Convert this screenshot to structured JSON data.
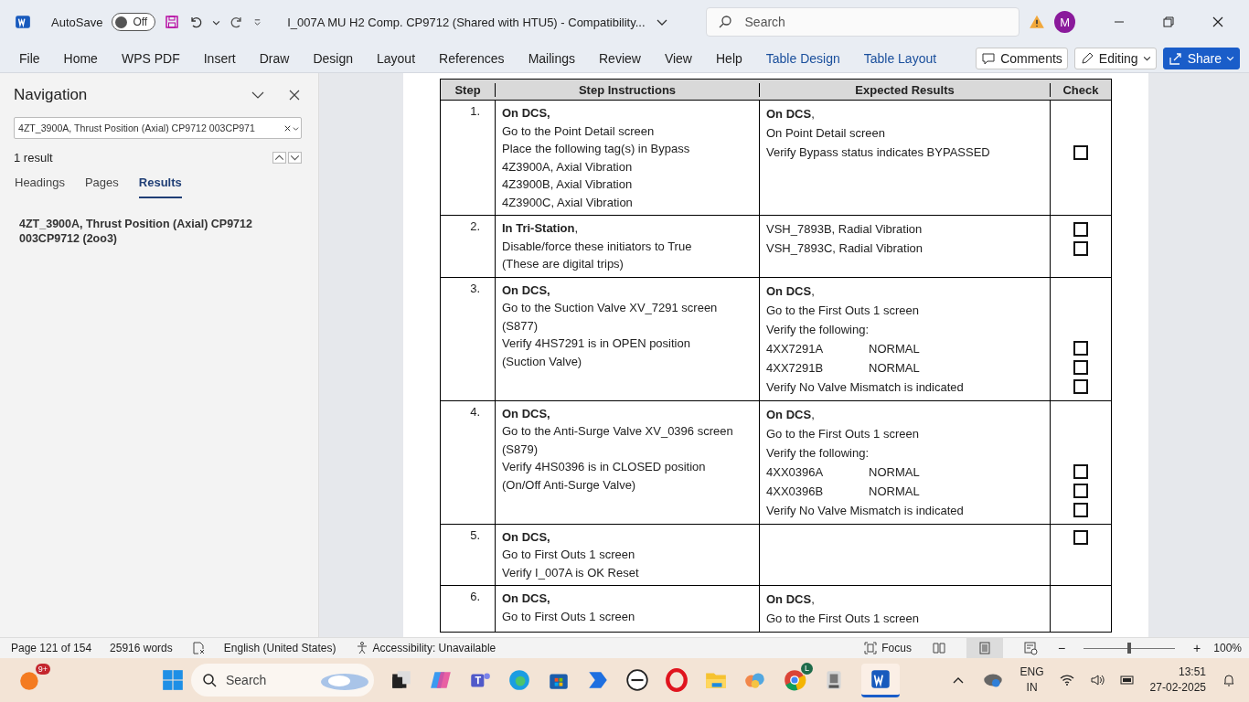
{
  "titlebar": {
    "autosave_label": "AutoSave",
    "autosave": {
      "label": "Off",
      "on": false
    },
    "document_title": "I_007A MU H2 Comp. CP9712 (Shared with HTU5)  -  Compatibility...",
    "search": {
      "placeholder": "Search"
    },
    "avatar": "M"
  },
  "ribbon": {
    "tabs": [
      {
        "label": "File",
        "kind": "standard"
      },
      {
        "label": "Home",
        "kind": "standard"
      },
      {
        "label": "WPS PDF",
        "kind": "standard"
      },
      {
        "label": "Insert",
        "kind": "standard"
      },
      {
        "label": "Draw",
        "kind": "standard"
      },
      {
        "label": "Design",
        "kind": "standard"
      },
      {
        "label": "Layout",
        "kind": "standard"
      },
      {
        "label": "References",
        "kind": "standard"
      },
      {
        "label": "Mailings",
        "kind": "standard"
      },
      {
        "label": "Review",
        "kind": "standard"
      },
      {
        "label": "View",
        "kind": "standard"
      },
      {
        "label": "Help",
        "kind": "standard"
      },
      {
        "label": "Table Design",
        "kind": "contextual"
      },
      {
        "label": "Table Layout",
        "kind": "contextual"
      }
    ],
    "comments": "Comments",
    "editing": "Editing",
    "share": "Share"
  },
  "navigation": {
    "title": "Navigation",
    "search": {
      "value": "4ZT_3900A, Thrust Position (Axial) CP9712 003CP971"
    },
    "result_count": "1 result",
    "tabs": [
      {
        "label": "Headings",
        "selected": false
      },
      {
        "label": "Pages",
        "selected": false
      },
      {
        "label": "Results",
        "selected": true
      }
    ],
    "results": [
      "4ZT_3900A, Thrust Position (Axial) CP9712 003CP9712 (2oo3)"
    ]
  },
  "table": {
    "columns": [
      "Step",
      "Step Instructions",
      "Expected Results",
      "Check"
    ],
    "rows": [
      {
        "step": "1.",
        "instructions": [
          {
            "text": "On DCS,",
            "bold": true
          },
          {
            "text": "Go to the Point Detail screen"
          },
          {
            "text": "Place the following tag(s) in Bypass"
          },
          {
            "text": "4Z3900A, Axial Vibration"
          },
          {
            "text": "4Z3900B, Axial Vibration"
          },
          {
            "text": "4Z3900C, Axial Vibration"
          }
        ],
        "expected": [
          {
            "text": "**On DCS**,"
          },
          {
            "text": "On Point Detail screen"
          },
          {
            "text": "Verify Bypass status indicates BYPASSED",
            "check": {
              "checked": false
            }
          }
        ]
      },
      {
        "step": "2.",
        "instructions": [
          {
            "text": "**In Tri-Station**,"
          },
          {
            "text": "Disable/force these initiators to True"
          },
          {
            "text": "(These are digital trips)"
          }
        ],
        "expected": [
          {
            "text": "VSH_7893B, Radial Vibration",
            "check": {
              "checked": false
            }
          },
          {
            "text": "VSH_7893C, Radial Vibration",
            "check": {
              "checked": false
            }
          }
        ]
      },
      {
        "step": "3.",
        "instructions": [
          {
            "text": "On DCS,",
            "bold": true
          },
          {
            "text": "Go to the Suction Valve XV_7291 screen"
          },
          {
            "text": "(S877)"
          },
          {
            "text": "Verify 4HS7291 is in OPEN position"
          },
          {
            "text": "(Suction Valve)"
          }
        ],
        "expected": [
          {
            "text": "**On DCS**,"
          },
          {
            "text": "Go to the First Outs 1 screen"
          },
          {
            "text": "Verify the following:"
          },
          {
            "text": "4XX7291A",
            "status": "NORMAL",
            "check": {
              "checked": false
            }
          },
          {
            "text": "4XX7291B",
            "status": "NORMAL",
            "check": {
              "checked": false
            }
          },
          {
            "text": "Verify No Valve Mismatch is indicated",
            "check": {
              "checked": false
            }
          }
        ]
      },
      {
        "step": "4.",
        "instructions": [
          {
            "text": "On DCS,",
            "bold": true
          },
          {
            "text": "Go to the Anti-Surge Valve XV_0396 screen"
          },
          {
            "text": "(S879)"
          },
          {
            "text": "Verify 4HS0396 is in CLOSED position"
          },
          {
            "text": "(On/Off Anti-Surge Valve)"
          }
        ],
        "expected": [
          {
            "text": "**On DCS**,"
          },
          {
            "text": "Go to the First Outs 1 screen"
          },
          {
            "text": "Verify the following:"
          },
          {
            "text": "4XX0396A",
            "status": "NORMAL",
            "check": {
              "checked": false
            }
          },
          {
            "text": "4XX0396B",
            "status": "NORMAL",
            "check": {
              "checked": false
            }
          },
          {
            "text": "Verify No Valve Mismatch is indicated",
            "check": {
              "checked": false
            }
          }
        ]
      },
      {
        "step": "5.",
        "instructions": [
          {
            "text": "On DCS,",
            "bold": true
          },
          {
            "text": "Go to First Outs 1 screen"
          },
          {
            "text": "Verify I_007A is OK Reset"
          }
        ],
        "expected": [
          {
            "check": {
              "checked": false
            }
          }
        ]
      },
      {
        "step": "6.",
        "instructions": [
          {
            "text": "On DCS,",
            "bold": true
          },
          {
            "text": "Go to First Outs 1 screen"
          }
        ],
        "expected": [
          {
            "text": "**On DCS**,"
          },
          {
            "text": "Go to the First Outs 1 screen"
          }
        ]
      }
    ]
  },
  "status_bar": {
    "page": "Page 121 of 154",
    "words": "25916 words",
    "language": "English (United States)",
    "accessibility": "Accessibility: Unavailable",
    "focus": "Focus",
    "zoom": {
      "level": 0.5,
      "label": "100%",
      "zoom_out": "−",
      "zoom_in": "+"
    }
  },
  "taskbar": {
    "notification_badge": "9+",
    "search": {
      "placeholder": "Search"
    },
    "chrome_badge": "L",
    "language": {
      "line1": "ENG",
      "line2": "IN"
    },
    "time": "13:51",
    "date": "27-02-2025"
  }
}
